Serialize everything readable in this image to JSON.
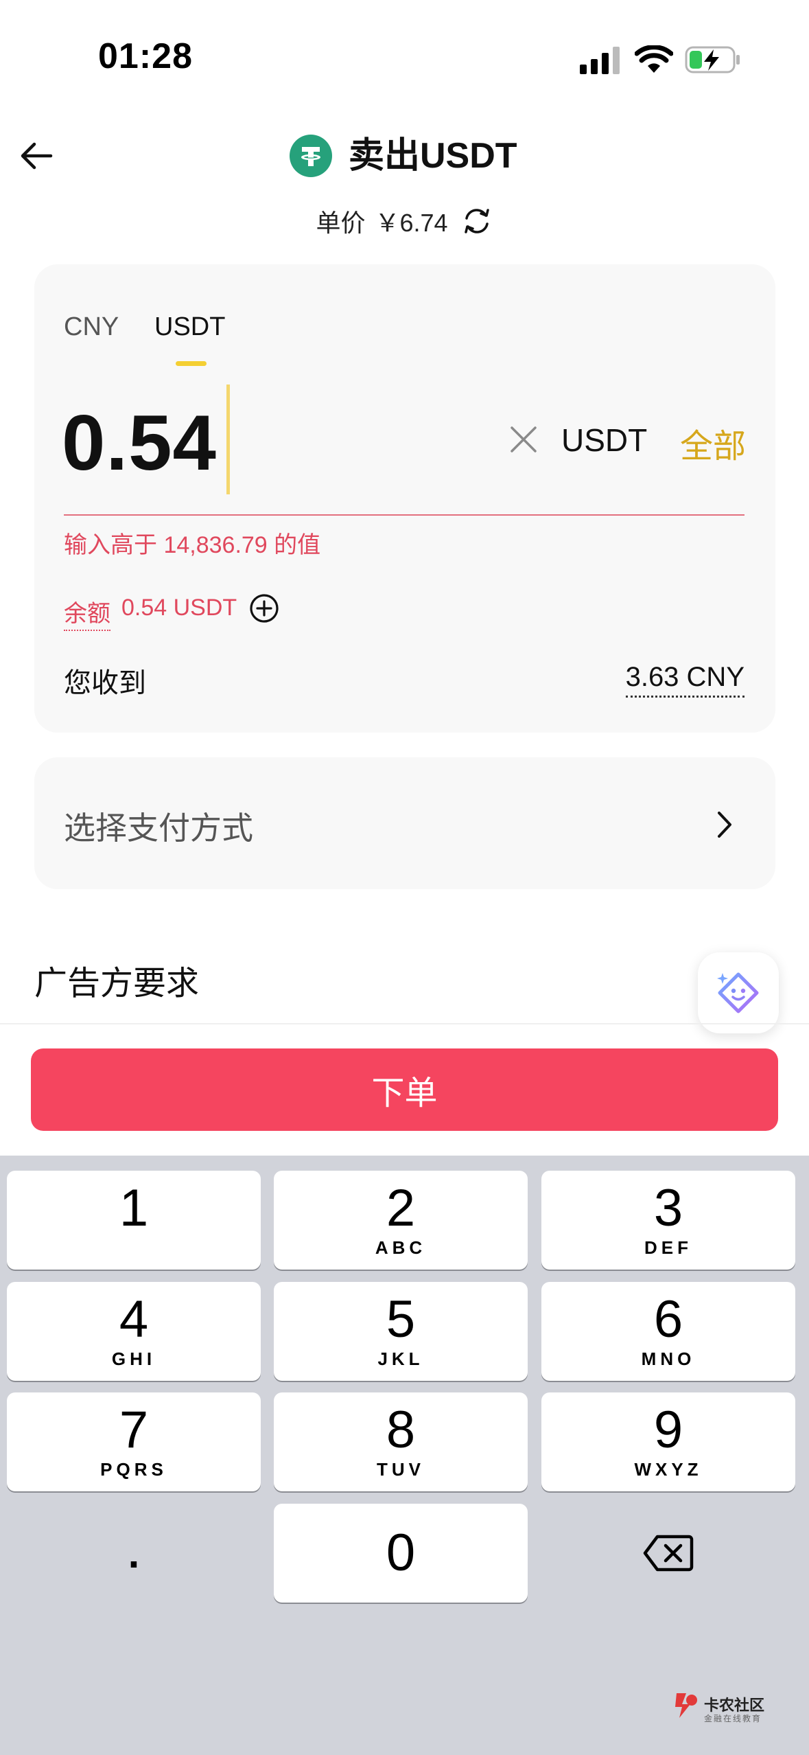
{
  "status_bar": {
    "time": "01:28"
  },
  "header": {
    "title": "卖出USDT",
    "coin_icon": "tether-coin-icon"
  },
  "price": {
    "label": "单价",
    "value": "￥6.74"
  },
  "tabs": [
    {
      "label": "CNY",
      "active": false
    },
    {
      "label": "USDT",
      "active": true
    }
  ],
  "amount_input": {
    "value": "0.54",
    "unit": "USDT",
    "all_label": "全部",
    "error": "输入高于 14,836.79  的值"
  },
  "balance": {
    "label": "余额",
    "value": "0.54 USDT"
  },
  "receive": {
    "label": "您收到",
    "value": "3.63 CNY"
  },
  "payment": {
    "label": "选择支付方式"
  },
  "advertiser": {
    "title": "广告方要求"
  },
  "order_button": {
    "label": "下单"
  },
  "keyboard": {
    "keys": [
      {
        "num": "1",
        "letters": ""
      },
      {
        "num": "2",
        "letters": "ABC"
      },
      {
        "num": "3",
        "letters": "DEF"
      },
      {
        "num": "4",
        "letters": "GHI"
      },
      {
        "num": "5",
        "letters": "JKL"
      },
      {
        "num": "6",
        "letters": "MNO"
      },
      {
        "num": "7",
        "letters": "PQRS"
      },
      {
        "num": "8",
        "letters": "TUV"
      },
      {
        "num": "9",
        "letters": "WXYZ"
      },
      {
        "num": "0",
        "letters": ""
      }
    ],
    "decimal": "."
  },
  "watermark": {
    "title": "卡农社区",
    "subtitle": "金融在线教育"
  },
  "colors": {
    "accent_red": "#f5455f",
    "error_red": "#e0485d",
    "gold": "#d6a71c",
    "tab_underline": "#f4cf33",
    "tether_green": "#26a17b"
  }
}
